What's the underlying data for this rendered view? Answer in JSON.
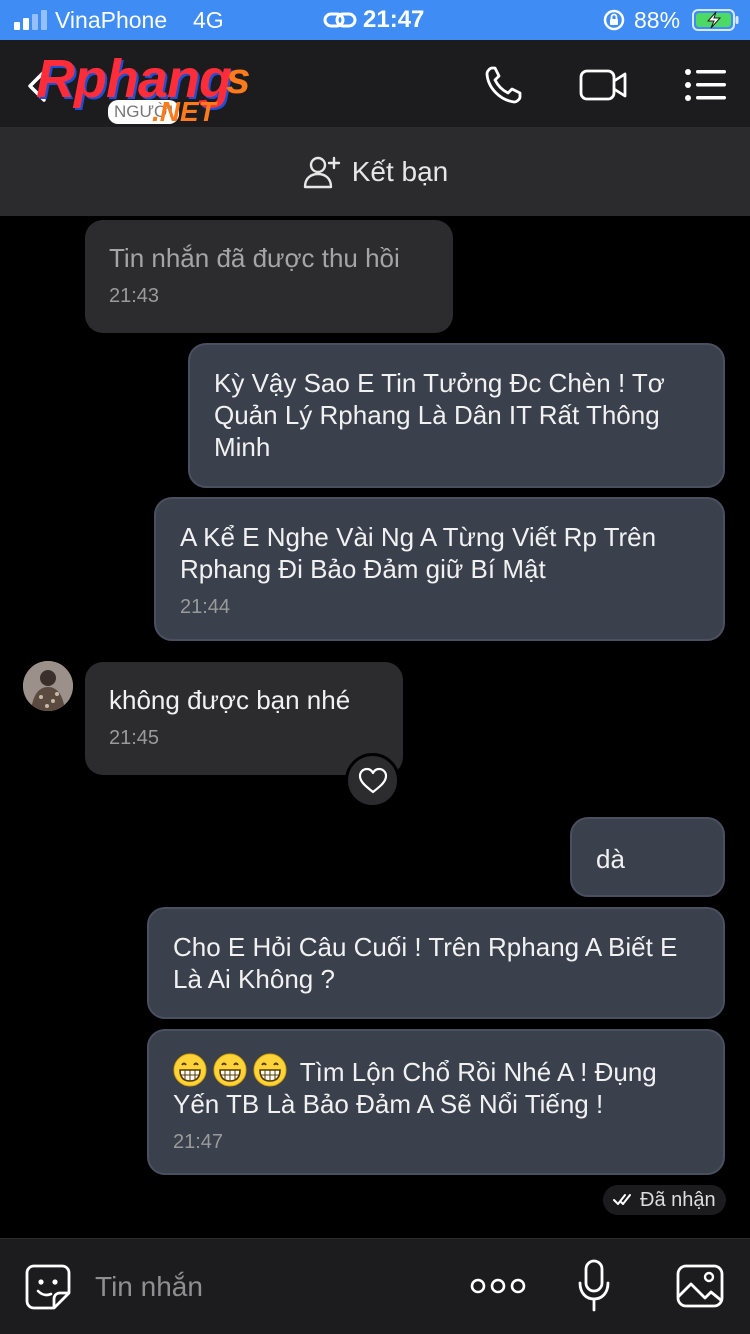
{
  "status_bar": {
    "carrier": "VinaPhone",
    "network": "4G",
    "time": "21:47",
    "battery_percent": "88%"
  },
  "header": {
    "logo_brand": "Rphang",
    "logo_brand_tail": "s",
    "logo_tag": "NGƯỜI",
    "logo_net": ".NET",
    "accent_color": "#3f8cf5"
  },
  "friend_bar": {
    "label": "Kết bạn"
  },
  "messages": [
    {
      "direction": "in",
      "text": "Tin nhắn đã được thu hồi",
      "time": "21:43",
      "recalled": true
    },
    {
      "direction": "out",
      "text": "Kỳ Vậy Sao E Tin Tưởng Đc Chèn ! Tơ Quản Lý Rphang Là Dân IT Rất Thông Minh",
      "time": ""
    },
    {
      "direction": "out",
      "text": "A Kể E Nghe Vài Ng A Từng Viết Rp Trên Rphang Đi Bảo Đảm giữ Bí Mật",
      "time": "21:44"
    },
    {
      "direction": "in",
      "text": "không được bạn nhé",
      "time": "21:45"
    },
    {
      "direction": "out",
      "text": "dà",
      "time": ""
    },
    {
      "direction": "out",
      "text": "Cho E Hỏi Câu Cuối ! Trên Rphang A Biết E Là Ai Không ?",
      "time": ""
    },
    {
      "direction": "out",
      "text": "Tìm Lộn Chổ Rồi Nhé A ! Đụng Yến TB Là Bảo Đảm A Sẽ Nổi Tiếng !",
      "time": "21:47",
      "emoji": [
        "grinning-face",
        "grinning-face",
        "grinning-face"
      ]
    }
  ],
  "delivery_status": "Đã nhận",
  "composer": {
    "placeholder": "Tin nhắn"
  },
  "icons": {
    "call": "phone-icon",
    "video": "video-camera-icon",
    "menu": "list-menu-icon",
    "sticker": "sticker-smile-icon",
    "more": "more-dots-icon",
    "mic": "microphone-icon",
    "image": "image-gallery-icon",
    "react": "heart-icon"
  }
}
